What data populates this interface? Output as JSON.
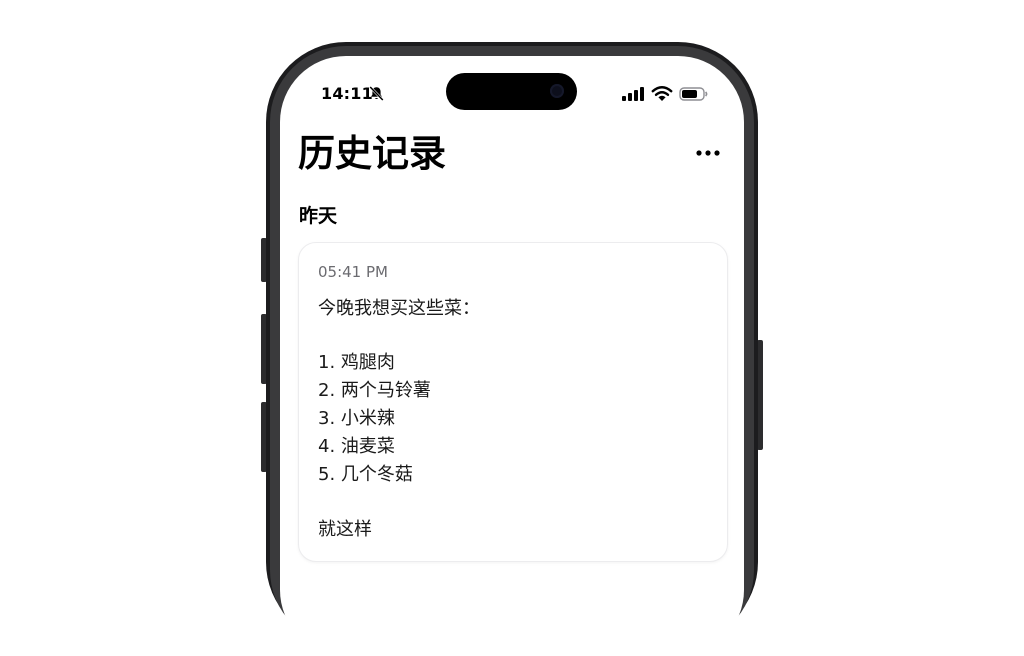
{
  "status_bar": {
    "time": "14:11",
    "silent_icon": "bell-slash-icon",
    "signal_icon": "cellular-signal-icon",
    "wifi_icon": "wifi-icon",
    "battery_icon": "battery-icon"
  },
  "header": {
    "title": "历史记录",
    "more_icon": "ellipsis-icon"
  },
  "section": {
    "label": "昨天"
  },
  "entry": {
    "time": "05:41 PM",
    "lines": [
      "今晚我想买这些菜：",
      "1. 鸡腿肉",
      "2. 两个马铃薯",
      "3. 小米辣",
      "4. 油麦菜",
      "5. 几个冬菇",
      "就这样"
    ]
  },
  "colors": {
    "frame": "#1c1c1e",
    "background": "#ffffff",
    "text": "#1a1a1a",
    "muted": "#6b6b70"
  }
}
